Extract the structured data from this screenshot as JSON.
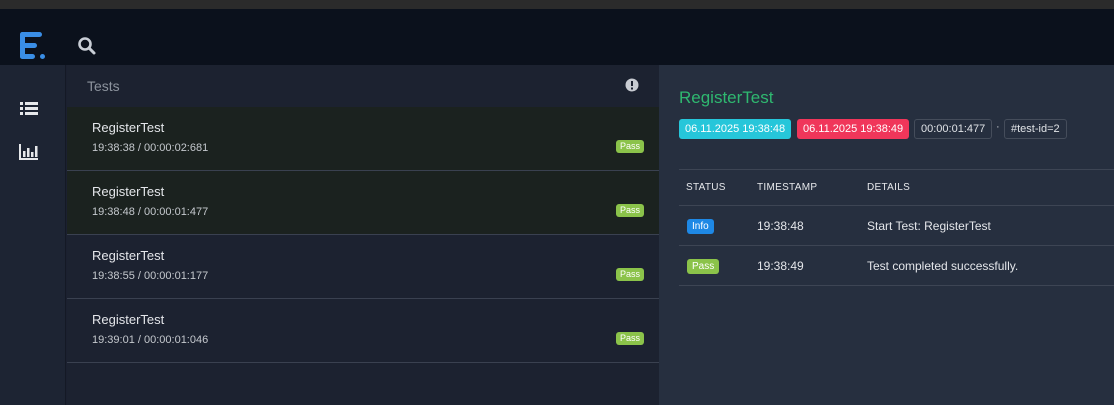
{
  "nav": {
    "logo_icon": "extent-logo-icon",
    "search_icon": "search-icon"
  },
  "sidebar": {
    "items": [
      {
        "icon": "list-icon"
      },
      {
        "icon": "bar-chart-icon"
      }
    ]
  },
  "test_panel": {
    "title": "Tests",
    "alert_icon": "exclamation-circle-icon",
    "tests": [
      {
        "name": "RegisterTest",
        "time": "19:38:38 / 00:00:02:681",
        "status": "Pass"
      },
      {
        "name": "RegisterTest",
        "time": "19:38:48 / 00:00:01:477",
        "status": "Pass"
      },
      {
        "name": "RegisterTest",
        "time": "19:38:55 / 00:00:01:177",
        "status": "Pass"
      },
      {
        "name": "RegisterTest",
        "time": "19:39:01 / 00:00:01:046",
        "status": "Pass"
      }
    ]
  },
  "detail": {
    "title": "RegisterTest",
    "start_time": "06.11.2025 19:38:48",
    "end_time": "06.11.2025 19:38:49",
    "duration": "00:00:01:477",
    "separator": "·",
    "test_id": "#test-id=2",
    "table": {
      "headers": [
        "STATUS",
        "TIMESTAMP",
        "DETAILS"
      ],
      "rows": [
        {
          "status": "Info",
          "timestamp": "19:38:48",
          "details": "Start Test: RegisterTest"
        },
        {
          "status": "Pass",
          "timestamp": "19:38:49",
          "details": "Test completed successfully."
        }
      ]
    }
  },
  "colors": {
    "pass": "#8bc34a",
    "info": "#1e88e5",
    "start_tag": "#26c6da",
    "end_tag": "#f0365a",
    "title_green": "#2fb870"
  }
}
